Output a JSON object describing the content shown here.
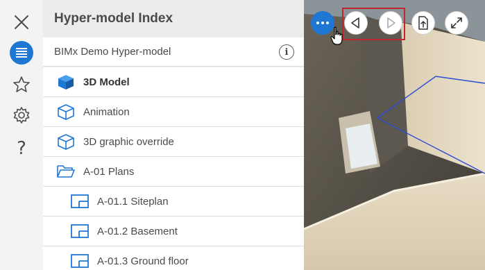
{
  "rail": {
    "close_icon": "close-icon",
    "index_icon": "list-icon",
    "favorites_icon": "star-icon",
    "settings_icon": "gear-icon",
    "help_label": "?"
  },
  "panel": {
    "title": "Hyper-model Index",
    "model_name": "BIMx Demo Hyper-model",
    "info_label": "i"
  },
  "tree": [
    {
      "label": "3D Model",
      "icon": "cube-filled-icon",
      "level": 0,
      "active": true
    },
    {
      "label": "Animation",
      "icon": "cube-outline-icon",
      "level": 0,
      "active": false
    },
    {
      "label": "3D graphic override",
      "icon": "cube-outline-icon",
      "level": 0,
      "active": false
    },
    {
      "label": "A-01 Plans",
      "icon": "folder-open-icon",
      "level": 0,
      "active": false
    },
    {
      "label": "A-01.1 Siteplan",
      "icon": "floorplan-icon",
      "level": 1,
      "active": false
    },
    {
      "label": "A-01.2 Basement",
      "icon": "floorplan-icon",
      "level": 1,
      "active": false
    },
    {
      "label": "A-01.3 Ground floor",
      "icon": "floorplan-icon",
      "level": 1,
      "active": false
    }
  ],
  "viewport": {
    "more_label": "•••",
    "buttons": [
      "more-icon",
      "back-icon",
      "forward-icon",
      "export-icon",
      "expand-icon"
    ],
    "accent_color": "#1e77d3",
    "highlight_color": "#c0262d"
  }
}
